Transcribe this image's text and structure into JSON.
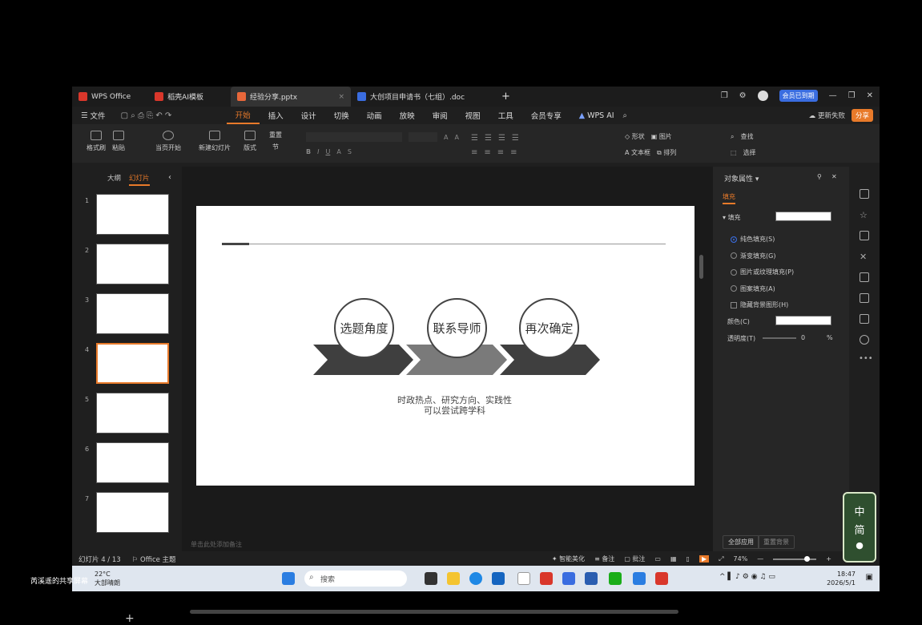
{
  "titlebar": {
    "tabs": [
      {
        "label": "WPS Office",
        "color": "#d9372b"
      },
      {
        "label": "稻壳AI模板",
        "color": "#d9372b"
      },
      {
        "label": "经验分享.pptx",
        "color": "#e8673a"
      },
      {
        "label": "大创项目申请书（七组）.doc",
        "color": "#3a6de0"
      }
    ],
    "vip_label": "会员已到期"
  },
  "menubar": {
    "file": "文件",
    "items": [
      "开始",
      "插入",
      "设计",
      "切换",
      "动画",
      "放映",
      "审阅",
      "视图",
      "工具",
      "会员专享"
    ],
    "ai": "WPS AI",
    "update_label": "更新失败",
    "share_label": "分享"
  },
  "ribbon": {
    "format_painter": "格式刷",
    "paste": "粘贴",
    "from_current": "当页开始",
    "new_slide": "新建幻灯片",
    "layout": "版式",
    "reset": "重置",
    "section": "节",
    "shape": "形状",
    "picture": "图片",
    "textbox": "文本框",
    "arrange": "排列",
    "find": "查找",
    "select": "选择"
  },
  "left_panel": {
    "tab_outline": "大纲",
    "tab_slides": "幻灯片",
    "slide_numbers": [
      "1",
      "2",
      "3",
      "4",
      "5",
      "6",
      "7"
    ],
    "selected_index": 3
  },
  "slide": {
    "circles": [
      "选题角度",
      "联系导师",
      "再次确定"
    ],
    "caption_line1": "时政热点、研究方向、实践性",
    "caption_line2": "可以尝试跨学科",
    "notes_placeholder": "单击此处添加备注"
  },
  "right_panel": {
    "title": "对象属性",
    "tab": "填充",
    "fill_label": "填充",
    "options": [
      {
        "label": "纯色填充(S)",
        "selected": true
      },
      {
        "label": "渐变填充(G)",
        "selected": false
      },
      {
        "label": "图片或纹理填充(P)",
        "selected": false
      },
      {
        "label": "图案填充(A)",
        "selected": false
      }
    ],
    "hide_bg": "隐藏背景图形(H)",
    "color_label": "颜色(C)",
    "transparency_label": "透明度(T)",
    "transparency_value": "0",
    "transparency_unit": "%",
    "apply_all": "全部应用",
    "reset_bg": "重置背景"
  },
  "statusbar": {
    "slide_info": "幻灯片 4 / 13",
    "theme": "Office 主题",
    "smart": "智能美化",
    "notes": "备注",
    "comments": "批注",
    "zoom": "74%",
    "zoom_fraction": 0.74
  },
  "taskbar": {
    "temp": "22°C",
    "weather": "大部晴朗",
    "search": "搜索",
    "time": "18:47",
    "date": "2026/5/1",
    "share_screen": "芮溪遥的共享屏幕"
  },
  "ime": {
    "line1": "中",
    "line2": "简"
  },
  "colors": {
    "accent": "#e87a2a",
    "blue": "#3a6de0"
  }
}
